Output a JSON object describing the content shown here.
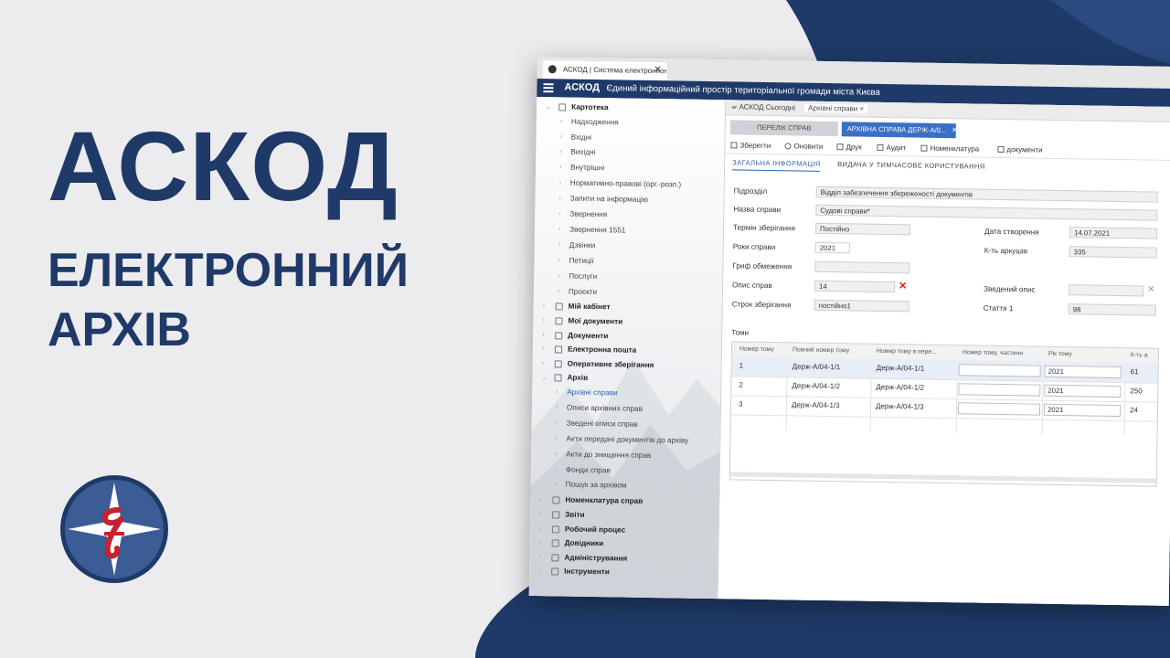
{
  "colors": {
    "navy": "#1f3a68",
    "accent": "#3a6fc4",
    "link": "#2d62b0",
    "bg": "#ececee",
    "logo_red": "#c8202f"
  },
  "hero": {
    "title": "АСКОД",
    "line2": "ЕЛЕКТРОННИЙ",
    "line3": "АРХІВ"
  },
  "browser": {
    "tab_title": "АСКОД | Система електронного"
  },
  "header": {
    "app": "АСКОД",
    "subtitle": "Єдиний інформаційний простір територіальної громади міста Києва"
  },
  "sidebar": {
    "items": [
      {
        "label": "Картотека",
        "level": 0,
        "icon": "folder-icon"
      },
      {
        "label": "Надходження",
        "level": 1
      },
      {
        "label": "Вхідні",
        "level": 1
      },
      {
        "label": "Вихідні",
        "level": 1
      },
      {
        "label": "Внутрішні",
        "level": 1
      },
      {
        "label": "Нормативно-правові (орг.-розп.)",
        "level": 1
      },
      {
        "label": "Запити на інформацію",
        "level": 1
      },
      {
        "label": "Звернення",
        "level": 1
      },
      {
        "label": "Звернення 1551",
        "level": 1
      },
      {
        "label": "Дзвінки",
        "level": 1
      },
      {
        "label": "Петиції",
        "level": 1
      },
      {
        "label": "Послуги",
        "level": 1
      },
      {
        "label": "Проєкти",
        "level": 1
      },
      {
        "label": "Мій кабінет",
        "level": 0,
        "icon": "cabinet-icon"
      },
      {
        "label": "Мої документи",
        "level": 0,
        "icon": "user-docs-icon"
      },
      {
        "label": "Документи",
        "level": 0,
        "icon": "document-icon"
      },
      {
        "label": "Електронна пошта",
        "level": 0,
        "icon": "mail-icon"
      },
      {
        "label": "Оперативне зберігання",
        "level": 0,
        "icon": "storage-icon"
      },
      {
        "label": "Архів",
        "level": 0,
        "icon": "archive-icon"
      },
      {
        "label": "Архівні справи",
        "level": 1,
        "active": true
      },
      {
        "label": "Описи архівних справ",
        "level": 1
      },
      {
        "label": "Зведені описи справ",
        "level": 1
      },
      {
        "label": "Акти передачі документів до архіву",
        "level": 1
      },
      {
        "label": "Акти до знищення справ",
        "level": 1
      },
      {
        "label": "Фонди справ",
        "level": 1
      },
      {
        "label": "Пошук за архівом",
        "level": 1
      },
      {
        "label": "Номенклатура справ",
        "level": 0,
        "icon": "nomenclature-icon"
      },
      {
        "label": "Звіти",
        "level": 0,
        "icon": "reports-icon"
      },
      {
        "label": "Робочий процес",
        "level": 0,
        "icon": "workflow-icon"
      },
      {
        "label": "Довідники",
        "level": 0,
        "icon": "book-icon"
      },
      {
        "label": "Адміністрування",
        "level": 0,
        "icon": "gear-icon"
      },
      {
        "label": "Інструменти",
        "level": 0,
        "icon": "wrench-icon"
      }
    ]
  },
  "main": {
    "tabs": [
      {
        "label": "АСКОД Сьогодні"
      },
      {
        "label": "Архівні справи",
        "close": "×"
      }
    ],
    "subtabs": [
      {
        "label": "ПЕРЕЛІК СПРАВ"
      },
      {
        "label": "АРХІВНА СПРАВА ДЕРЖ-А/0...",
        "close": "×"
      }
    ],
    "toolbar": [
      "Зберегти",
      "Оновити",
      "Друк",
      "Аудит",
      "Номенклатура",
      "документи"
    ],
    "content_tabs": [
      "ЗАГАЛЬНА ІНФОРМАЦІЯ",
      "ВИДАЧА У ТИМЧАСОВЕ КОРИСТУВАННЯ"
    ],
    "form": {
      "pidrozdil_label": "Підрозділ",
      "pidrozdil_value": "Відділ забезпечення збереженості документів",
      "nazva_label": "Назва справи",
      "nazva_value": "Судові справи*",
      "termin_label": "Термін зберігання",
      "termin_value": "Постійно",
      "data_label": "Дата створення",
      "data_value": "14.07.2021",
      "roky_label": "Роки справи",
      "roky_value": "2021",
      "kt_label": "К-ть аркушів",
      "kt_value": "335",
      "hryf_label": "Гриф обмеження",
      "hryf_value": "",
      "opys_label": "Опис справ",
      "opys_value": "14",
      "zved_label": "Зведений опис",
      "zved_value": "",
      "strok_label": "Строк зберігання",
      "strok_value": "постійно1",
      "stattia_label": "Стаття 1",
      "stattia_value": "98"
    },
    "volumes": {
      "title": "Томи",
      "columns": [
        "Номер тому",
        "Повний номер тому",
        "Номер тому в пере...",
        "Номер тому, частини",
        "Рік тому",
        "К-ть а"
      ],
      "rows": [
        {
          "n": "1",
          "full": "Держ-А/04-1/1",
          "per": "Держ-А/04-1/1",
          "part": "",
          "year": "2021",
          "count": "61"
        },
        {
          "n": "2",
          "full": "Держ-А/04-1/2",
          "per": "Держ-А/04-1/2",
          "part": "",
          "year": "2021",
          "count": "250"
        },
        {
          "n": "3",
          "full": "Держ-А/04-1/3",
          "per": "Держ-А/04-1/3",
          "part": "",
          "year": "2021",
          "count": "24"
        }
      ]
    }
  }
}
